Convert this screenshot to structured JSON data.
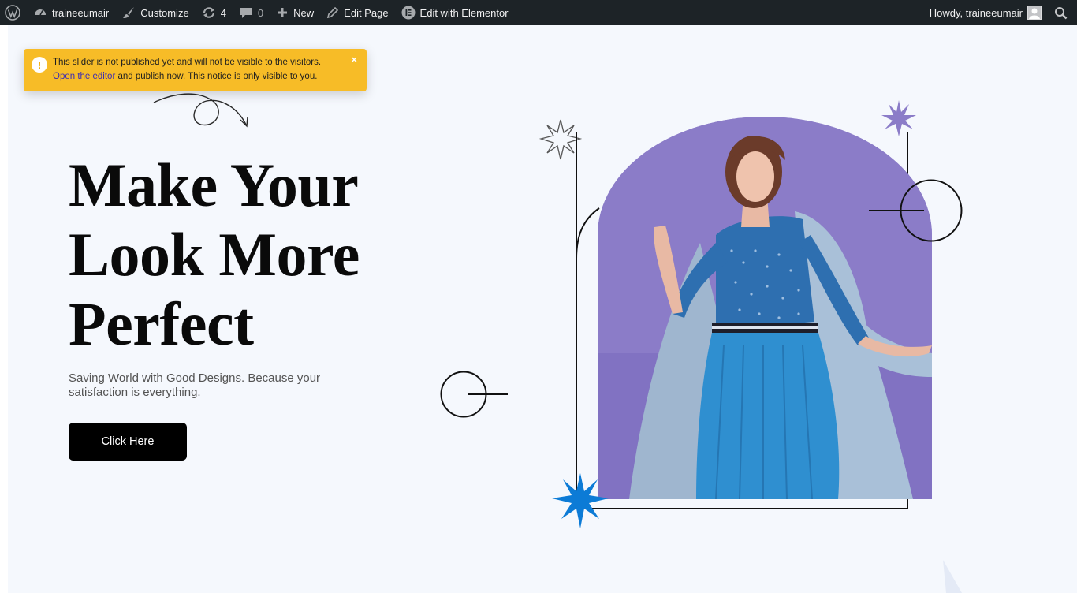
{
  "adminbar": {
    "site_name": "traineeumair",
    "customize": "Customize",
    "updates_count": "4",
    "comments_count": "0",
    "new": "New",
    "edit_page": "Edit Page",
    "edit_elementor": "Edit with Elementor",
    "howdy": "Howdy, traineeumair",
    "icons": [
      "wordpress-icon",
      "dashboard-icon",
      "brush-icon",
      "updates-icon",
      "comment-icon",
      "plus-icon",
      "pencil-icon",
      "elementor-icon",
      "search-icon"
    ]
  },
  "notice": {
    "line1": "This slider is not published yet and will not be visible to the visitors.",
    "link": "Open the editor",
    "line2_rest": " and publish now. This notice is only visible to you.",
    "close": "×",
    "icon": "!",
    "color": "#f7bc27"
  },
  "hero": {
    "title_lines": [
      "Make Your",
      "Look More",
      "Perfect"
    ],
    "subtitle": "Saving World with Good Designs. Because your satisfaction is everything.",
    "button": "Click Here"
  },
  "colors": {
    "adminbar_bg": "#1d2327",
    "page_bg": "#f5f8fd",
    "photo_bg": "#8b7cc8",
    "star_purple": "#8b7cc8",
    "star_blue": "#0c7bd6"
  }
}
